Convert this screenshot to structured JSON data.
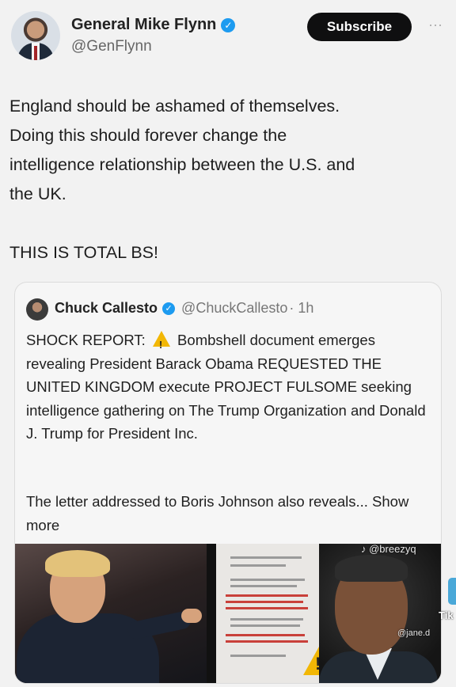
{
  "author": {
    "display_name": "General Mike Flynn",
    "handle": "@GenFlynn",
    "verified_glyph": "✓",
    "avatar_icon": "avatar-photo"
  },
  "actions": {
    "subscribe_label": "Subscribe",
    "more_label": "···"
  },
  "tweet": {
    "text": "England should be ashamed of themselves.\nDoing this should forever change the\nintelligence relationship between the U.S. and\nthe UK.\n\nTHIS IS TOTAL BS!"
  },
  "quote": {
    "display_name": "Chuck Callesto",
    "handle": "@ChuckCallesto",
    "time": "· 1h",
    "verified_glyph": "✓",
    "body_prefix": "SHOCK REPORT: ",
    "body_rest": " Bombshell document emerges revealing President Barack Obama REQUESTED THE UNITED KINGDOM execute PROJECT FULSOME seeking intelligence gathering on The Trump Organization and Donald J. Trump for President Inc.",
    "more_text": "The letter addressed to Boris Johnson also reveals...",
    "show_more_label": "Show more"
  },
  "watermarks": {
    "top": "♪ @breezyq",
    "side": "@jane.d",
    "tik": "Tik"
  },
  "colors": {
    "verified": "#1d9bf0",
    "subscribe_bg": "#0f0f10",
    "warning": "#f2b705"
  }
}
